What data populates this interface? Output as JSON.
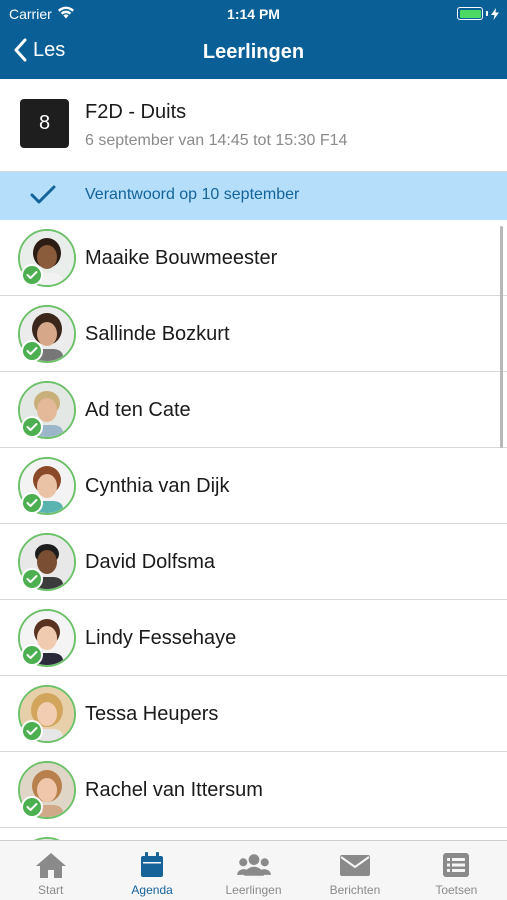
{
  "status_bar": {
    "carrier": "Carrier",
    "time": "1:14 PM"
  },
  "nav": {
    "back_label": "Les",
    "title": "Leerlingen"
  },
  "lesson": {
    "hour": "8",
    "title": "F2D - Duits",
    "subtitle": "6 september van 14:45 tot 15:30 F14"
  },
  "answered": {
    "text": "Verantwoord op 10 september"
  },
  "students": [
    {
      "name": "Maaike Bouwmeester"
    },
    {
      "name": "Sallinde Bozkurt"
    },
    {
      "name": "Ad ten Cate"
    },
    {
      "name": "Cynthia van Dijk"
    },
    {
      "name": "David Dolfsma"
    },
    {
      "name": "Lindy Fessehaye"
    },
    {
      "name": "Tessa Heupers"
    },
    {
      "name": "Rachel van Ittersum"
    }
  ],
  "tabs": [
    {
      "label": "Start",
      "icon": "home-icon"
    },
    {
      "label": "Agenda",
      "icon": "calendar-icon",
      "active": true
    },
    {
      "label": "Leerlingen",
      "icon": "people-icon"
    },
    {
      "label": "Berichten",
      "icon": "envelope-icon"
    },
    {
      "label": "Toetsen",
      "icon": "list-icon"
    }
  ],
  "colors": {
    "nav_bg": "#0a5f97",
    "banner_bg": "#b4defa",
    "check_green": "#4caf50",
    "active_tab": "#16639a"
  }
}
